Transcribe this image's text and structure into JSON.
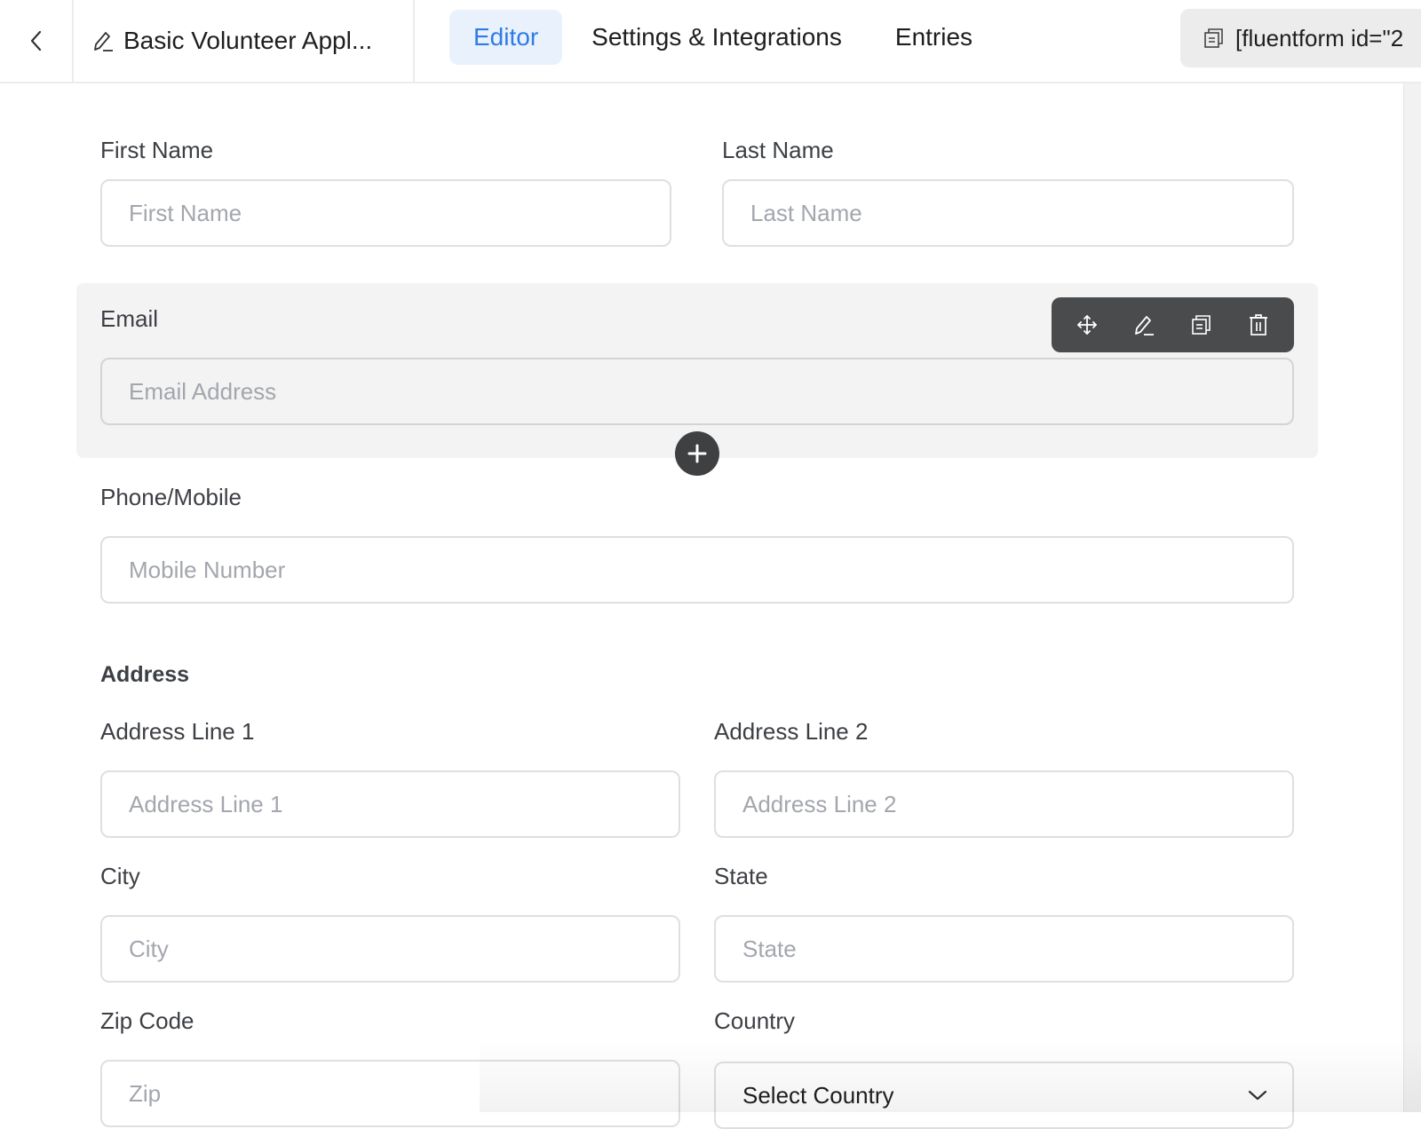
{
  "header": {
    "back_icon": "chevron-left-icon",
    "form_title": "Basic Volunteer Appl...",
    "title_icon": "pencil-edit-icon",
    "tabs": [
      {
        "label": "Editor",
        "active": true
      },
      {
        "label": "Settings & Integrations",
        "active": false
      },
      {
        "label": "Entries",
        "active": false
      }
    ],
    "shortcode": {
      "icon": "copy-icon",
      "text": "[fluentform id=\"2"
    }
  },
  "colors": {
    "accent": "#2f7be5",
    "active_tab_bg": "#e9f1fd",
    "toolbar_bg": "#4a4b4d",
    "selected_field_bg": "#f3f3f3"
  },
  "form": {
    "first_name": {
      "label": "First Name",
      "placeholder": "First Name"
    },
    "last_name": {
      "label": "Last Name",
      "placeholder": "Last Name"
    },
    "email": {
      "label": "Email",
      "placeholder": "Email Address"
    },
    "field_toolbar": {
      "icons": [
        "move-icon",
        "edit-icon",
        "duplicate-icon",
        "trash-icon"
      ]
    },
    "add_field_icon": "plus-icon",
    "phone": {
      "label": "Phone/Mobile",
      "placeholder": "Mobile Number"
    },
    "address": {
      "section_label": "Address",
      "line1": {
        "label": "Address Line 1",
        "placeholder": "Address Line 1"
      },
      "line2": {
        "label": "Address Line 2",
        "placeholder": "Address Line 2"
      },
      "city": {
        "label": "City",
        "placeholder": "City"
      },
      "state": {
        "label": "State",
        "placeholder": "State"
      },
      "zip": {
        "label": "Zip Code",
        "placeholder": "Zip"
      },
      "country": {
        "label": "Country",
        "selected": "Select Country"
      }
    }
  }
}
